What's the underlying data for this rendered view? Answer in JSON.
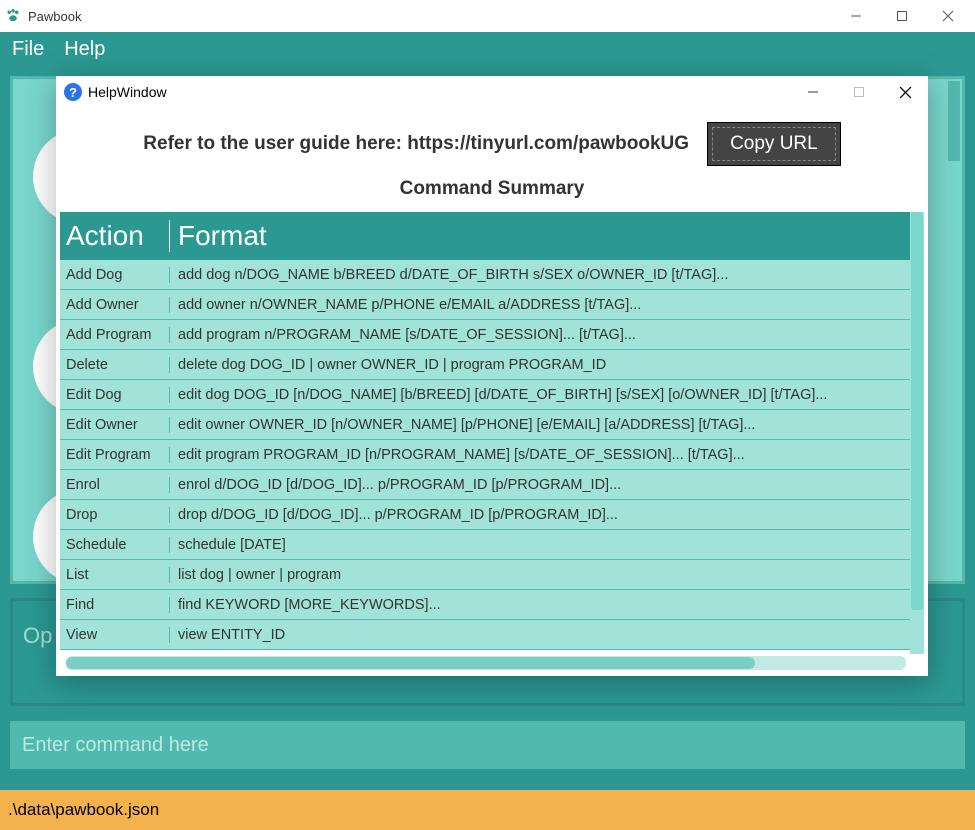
{
  "app": {
    "title": "Pawbook"
  },
  "menu": {
    "file": "File",
    "help": "Help"
  },
  "opPanel": "Op",
  "commandInput": {
    "placeholder": "Enter command here"
  },
  "statusbar": ".\\data\\pawbook.json",
  "helpWindow": {
    "title": "HelpWindow",
    "referText": "Refer to the user guide here: https://tinyurl.com/pawbookUG",
    "copyButton": "Copy URL",
    "summaryTitle": "Command Summary",
    "headers": {
      "action": "Action",
      "format": "Format"
    },
    "rows": [
      {
        "action": "Add Dog",
        "format": "add dog n/DOG_NAME b/BREED d/DATE_OF_BIRTH s/SEX o/OWNER_ID [t/TAG]..."
      },
      {
        "action": "Add Owner",
        "format": "add owner n/OWNER_NAME p/PHONE e/EMAIL a/ADDRESS [t/TAG]..."
      },
      {
        "action": "Add Program",
        "format": "add program n/PROGRAM_NAME [s/DATE_OF_SESSION]... [t/TAG]..."
      },
      {
        "action": "Delete",
        "format": "delete dog DOG_ID | owner OWNER_ID | program PROGRAM_ID"
      },
      {
        "action": "Edit Dog",
        "format": "edit dog DOG_ID [n/DOG_NAME] [b/BREED] [d/DATE_OF_BIRTH] [s/SEX] [o/OWNER_ID] [t/TAG]..."
      },
      {
        "action": "Edit Owner",
        "format": "edit owner OWNER_ID [n/OWNER_NAME] [p/PHONE] [e/EMAIL] [a/ADDRESS] [t/TAG]..."
      },
      {
        "action": "Edit Program",
        "format": "edit program PROGRAM_ID [n/PROGRAM_NAME] [s/DATE_OF_SESSION]... [t/TAG]..."
      },
      {
        "action": "Enrol",
        "format": "enrol d/DOG_ID [d/DOG_ID]... p/PROGRAM_ID [p/PROGRAM_ID]..."
      },
      {
        "action": "Drop",
        "format": "drop d/DOG_ID [d/DOG_ID]... p/PROGRAM_ID [p/PROGRAM_ID]..."
      },
      {
        "action": "Schedule",
        "format": "schedule [DATE]"
      },
      {
        "action": "List",
        "format": "list dog | owner | program"
      },
      {
        "action": "Find",
        "format": "find KEYWORD [MORE_KEYWORDS]..."
      },
      {
        "action": "View",
        "format": "view ENTITY_ID"
      }
    ]
  }
}
